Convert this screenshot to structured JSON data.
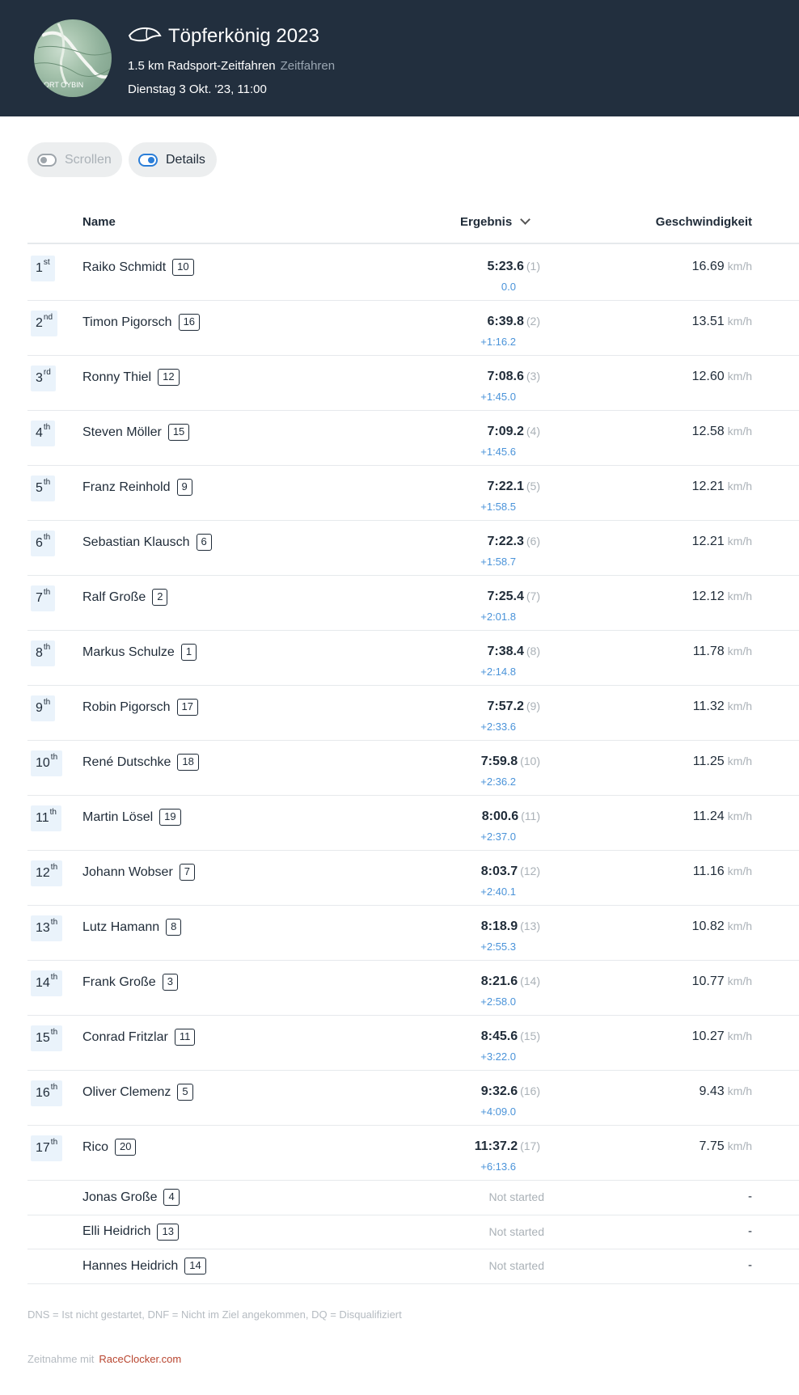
{
  "header": {
    "title": "Töpferkönig 2023",
    "distance_and_type": "1.5 km Radsport-Zeitfahren",
    "discipline": "Zeitfahren",
    "datetime": "Dienstag 3 Okt. '23, 11:00",
    "map_label": "ORT OYBIN",
    "icon": "aero-helmet-icon"
  },
  "toggles": {
    "scroll_label": "Scrollen",
    "scroll_on": false,
    "details_label": "Details",
    "details_on": true
  },
  "table": {
    "col_name": "Name",
    "col_result": "Ergebnis",
    "col_speed": "Geschwindigkeit",
    "speed_unit": "km/h",
    "finishers": [
      {
        "rank": "1",
        "suffix": "st",
        "name": "Raiko Schmidt",
        "bib": "10",
        "time": "5:23.6",
        "pos": "(1)",
        "gap": "0.0",
        "speed": "16.69"
      },
      {
        "rank": "2",
        "suffix": "nd",
        "name": "Timon Pigorsch",
        "bib": "16",
        "time": "6:39.8",
        "pos": "(2)",
        "gap": "+1:16.2",
        "speed": "13.51"
      },
      {
        "rank": "3",
        "suffix": "rd",
        "name": "Ronny Thiel",
        "bib": "12",
        "time": "7:08.6",
        "pos": "(3)",
        "gap": "+1:45.0",
        "speed": "12.60"
      },
      {
        "rank": "4",
        "suffix": "th",
        "name": "Steven Möller",
        "bib": "15",
        "time": "7:09.2",
        "pos": "(4)",
        "gap": "+1:45.6",
        "speed": "12.58"
      },
      {
        "rank": "5",
        "suffix": "th",
        "name": "Franz Reinhold",
        "bib": "9",
        "time": "7:22.1",
        "pos": "(5)",
        "gap": "+1:58.5",
        "speed": "12.21"
      },
      {
        "rank": "6",
        "suffix": "th",
        "name": "Sebastian Klausch",
        "bib": "6",
        "time": "7:22.3",
        "pos": "(6)",
        "gap": "+1:58.7",
        "speed": "12.21"
      },
      {
        "rank": "7",
        "suffix": "th",
        "name": "Ralf Große",
        "bib": "2",
        "time": "7:25.4",
        "pos": "(7)",
        "gap": "+2:01.8",
        "speed": "12.12"
      },
      {
        "rank": "8",
        "suffix": "th",
        "name": "Markus Schulze",
        "bib": "1",
        "time": "7:38.4",
        "pos": "(8)",
        "gap": "+2:14.8",
        "speed": "11.78"
      },
      {
        "rank": "9",
        "suffix": "th",
        "name": "Robin Pigorsch",
        "bib": "17",
        "time": "7:57.2",
        "pos": "(9)",
        "gap": "+2:33.6",
        "speed": "11.32"
      },
      {
        "rank": "10",
        "suffix": "th",
        "name": "René Dutschke",
        "bib": "18",
        "time": "7:59.8",
        "pos": "(10)",
        "gap": "+2:36.2",
        "speed": "11.25"
      },
      {
        "rank": "11",
        "suffix": "th",
        "name": "Martin Lösel",
        "bib": "19",
        "time": "8:00.6",
        "pos": "(11)",
        "gap": "+2:37.0",
        "speed": "11.24"
      },
      {
        "rank": "12",
        "suffix": "th",
        "name": "Johann Wobser",
        "bib": "7",
        "time": "8:03.7",
        "pos": "(12)",
        "gap": "+2:40.1",
        "speed": "11.16"
      },
      {
        "rank": "13",
        "suffix": "th",
        "name": "Lutz Hamann",
        "bib": "8",
        "time": "8:18.9",
        "pos": "(13)",
        "gap": "+2:55.3",
        "speed": "10.82"
      },
      {
        "rank": "14",
        "suffix": "th",
        "name": "Frank Große",
        "bib": "3",
        "time": "8:21.6",
        "pos": "(14)",
        "gap": "+2:58.0",
        "speed": "10.77"
      },
      {
        "rank": "15",
        "suffix": "th",
        "name": "Conrad Fritzlar",
        "bib": "11",
        "time": "8:45.6",
        "pos": "(15)",
        "gap": "+3:22.0",
        "speed": "10.27"
      },
      {
        "rank": "16",
        "suffix": "th",
        "name": "Oliver Clemenz",
        "bib": "5",
        "time": "9:32.6",
        "pos": "(16)",
        "gap": "+4:09.0",
        "speed": "9.43"
      },
      {
        "rank": "17",
        "suffix": "th",
        "name": "Rico",
        "bib": "20",
        "time": "11:37.2",
        "pos": "(17)",
        "gap": "+6:13.6",
        "speed": "7.75"
      }
    ],
    "non_starters": [
      {
        "name": "Jonas Große",
        "bib": "4",
        "status": "Not started",
        "speed": "-"
      },
      {
        "name": "Elli Heidrich",
        "bib": "13",
        "status": "Not started",
        "speed": "-"
      },
      {
        "name": "Hannes Heidrich",
        "bib": "14",
        "status": "Not started",
        "speed": "-"
      }
    ]
  },
  "legend": "DNS = Ist nicht gestartet,   DNF = Nicht im Ziel angekommen,   DQ = Disqualifiziert",
  "footer": {
    "prefix": "Zeitnahme mit",
    "link": "RaceClocker.com"
  },
  "colors": {
    "header_bg": "#222f3e",
    "gap_blue": "#4a93d9",
    "rank_bg": "#eaf3fb",
    "link": "#b8452f"
  }
}
